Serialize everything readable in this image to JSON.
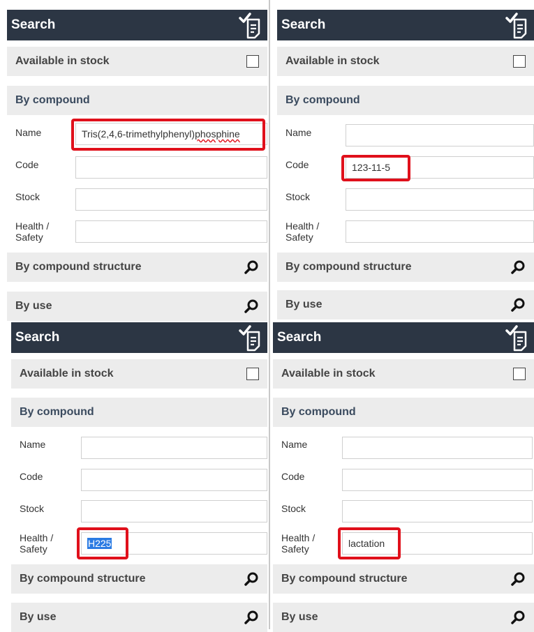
{
  "common": {
    "header_title": "Search",
    "available_label": "Available in stock",
    "by_compound_label": "By compound",
    "name_label": "Name",
    "code_label": "Code",
    "stock_label": "Stock",
    "health_label_line1": "Health /",
    "health_label_line2": "Safety",
    "by_structure_label": "By compound structure",
    "by_use_label": "By use"
  },
  "panels": [
    {
      "name_value_prefix": "Tris(2,4,6-trimethylphenyl)",
      "name_value_suffix": "phosphine",
      "code_value": "",
      "health_value": ""
    },
    {
      "name_value": "",
      "code_value": "123-11-5",
      "health_value": ""
    },
    {
      "name_value": "",
      "code_value": "",
      "health_value": "H225"
    },
    {
      "name_value": "",
      "code_value": "",
      "health_value": "lactation"
    }
  ],
  "colors": {
    "header_bg": "#2c3644",
    "highlight": "#e0101b",
    "bar_bg": "#ececec",
    "selection": "#2b7be3"
  }
}
